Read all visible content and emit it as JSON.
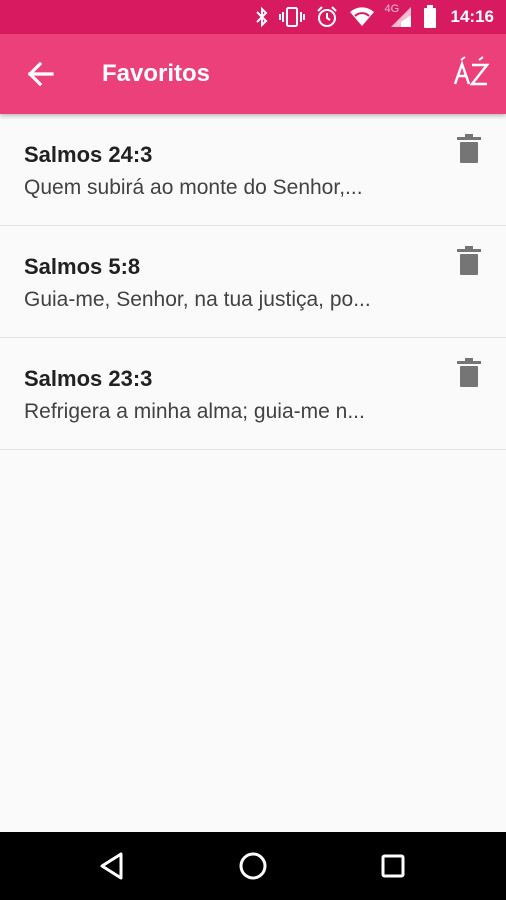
{
  "status_bar": {
    "time": "14:16",
    "network": "4G",
    "icons": [
      "bluetooth-icon",
      "vibrate-icon",
      "alarm-icon",
      "wifi-icon",
      "signal-icon",
      "battery-icon"
    ]
  },
  "app_bar": {
    "title": "Favoritos",
    "back_icon": "arrow-back-icon",
    "sort_icon": "sort-az-icon"
  },
  "favorites": [
    {
      "title": "Salmos 24:3",
      "text": "Quem subirá ao monte do Senhor,..."
    },
    {
      "title": "Salmos 5:8",
      "text": "Guia-me, Senhor, na tua justiça, po..."
    },
    {
      "title": "Salmos 23:3",
      "text": "Refrigera a minha alma; guia-me n..."
    }
  ],
  "nav_bar": {
    "icons": [
      "back-triangle-icon",
      "home-circle-icon",
      "recents-square-icon"
    ]
  },
  "colors": {
    "status_bar": "#d81b60",
    "app_bar": "#ec407a",
    "background": "#fafafa",
    "divider": "#e0e0e0",
    "delete_icon": "#757575"
  }
}
